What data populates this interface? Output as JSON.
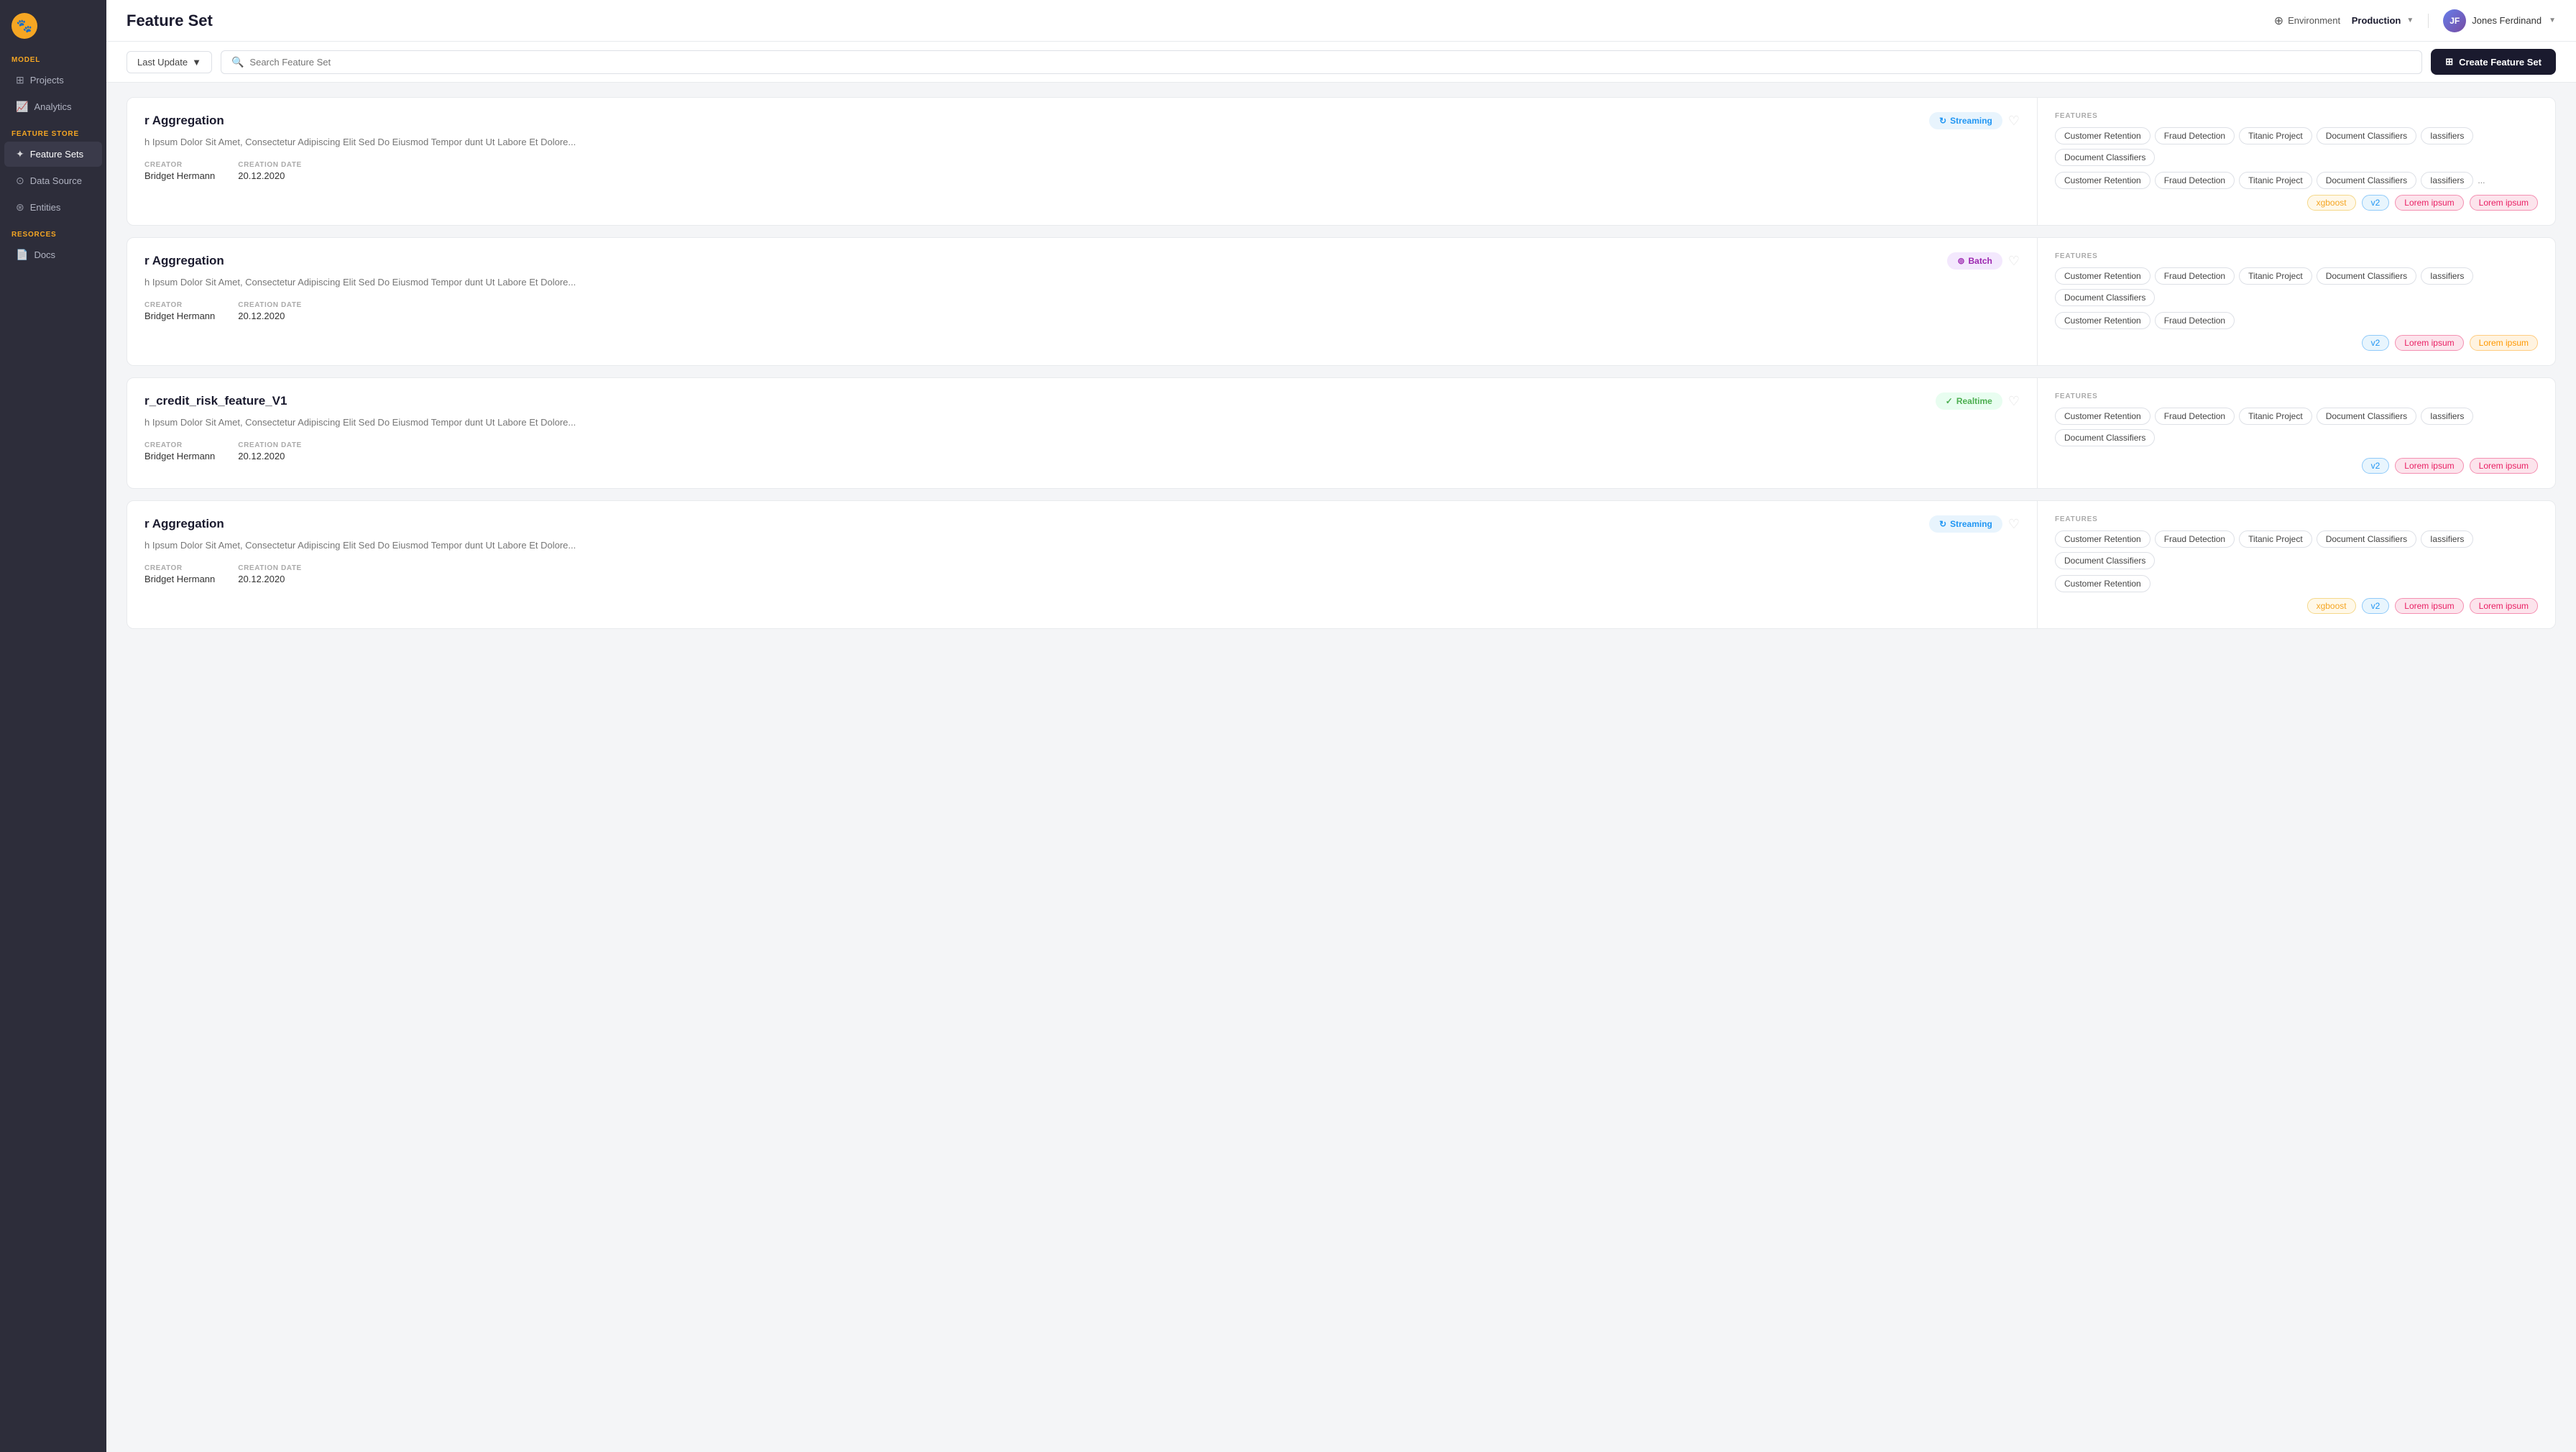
{
  "sidebar": {
    "logo": "🐾",
    "sections": [
      {
        "label": "MODEL",
        "items": [
          {
            "id": "projects",
            "icon": "⊞",
            "label": "Projects",
            "active": false
          },
          {
            "id": "analytics",
            "icon": "📈",
            "label": "Analytics",
            "active": false
          }
        ]
      },
      {
        "label": "FEATURE STORE",
        "items": [
          {
            "id": "feature-sets",
            "icon": "✦",
            "label": "Feature Sets",
            "active": true
          },
          {
            "id": "data-source",
            "icon": "⊙",
            "label": "Data Source",
            "active": false
          },
          {
            "id": "entities",
            "icon": "⊛",
            "label": "Entities",
            "active": false
          }
        ]
      },
      {
        "label": "RESORCES",
        "items": [
          {
            "id": "docs",
            "icon": "📄",
            "label": "Docs",
            "active": false
          }
        ]
      }
    ]
  },
  "header": {
    "title": "Feature Set",
    "environment_label": "Environment",
    "environment_value": "Production",
    "user_name": "Jones Ferdinand",
    "user_initials": "JF"
  },
  "toolbar": {
    "filter_label": "Last Update",
    "search_placeholder": "Search Feature Set",
    "create_label": "Create Feature Set"
  },
  "cards": [
    {
      "id": "card-1",
      "title": "r Aggregation",
      "type": "Streaming",
      "type_variant": "streaming",
      "liked": false,
      "description": "h Ipsum Dolor Sit Amet, Consectetur Adipiscing Elit Sed Do Eiusmod Tempor dunt Ut Labore Et Dolore...",
      "creator": "Bridget Hermann",
      "creation_date": "20.12.2020",
      "creator_label": "CREATOR",
      "date_label": "CREATION DATE",
      "features_label": "FEATURES",
      "features_row1": [
        "Customer Retention",
        "Fraud Detection",
        "Titanic Project",
        "Document Classifiers",
        "Iassifiers",
        "Document Classifiers"
      ],
      "features_row2": [
        "Customer Retention",
        "Fraud Detection",
        "Titanic Project",
        "Document Classifiers",
        "Iassifiers"
      ],
      "features_more": "...",
      "versions": [
        {
          "label": "xgboost",
          "style": "xgboost"
        },
        {
          "label": "v2",
          "style": "v2"
        },
        {
          "label": "Lorem ipsum",
          "style": "pink"
        },
        {
          "label": "Lorem ipsum",
          "style": "pink"
        }
      ]
    },
    {
      "id": "card-2",
      "title": "r Aggregation",
      "type": "Batch",
      "type_variant": "batch",
      "liked": false,
      "description": "h Ipsum Dolor Sit Amet, Consectetur Adipiscing Elit Sed Do Eiusmod Tempor dunt Ut Labore Et Dolore...",
      "creator": "Bridget Hermann",
      "creation_date": "20.12.2020",
      "creator_label": "CREATOR",
      "date_label": "CREATION DATE",
      "features_label": "FEATURES",
      "features_row1": [
        "Customer Retention",
        "Fraud Detection",
        "Titanic Project",
        "Document Classifiers",
        "Iassifiers",
        "Document Classifiers"
      ],
      "features_row2": [
        "Customer Retention",
        "Fraud Detection"
      ],
      "features_more": "",
      "versions": [
        {
          "label": "v2",
          "style": "v2"
        },
        {
          "label": "Lorem ipsum",
          "style": "pink"
        },
        {
          "label": "Lorem ipsum",
          "style": "orange"
        }
      ]
    },
    {
      "id": "card-3",
      "title": "r_credit_risk_feature_V1",
      "type": "Realtime",
      "type_variant": "realtime",
      "liked": false,
      "description": "h Ipsum Dolor Sit Amet, Consectetur Adipiscing Elit Sed Do Eiusmod Tempor dunt Ut Labore Et Dolore...",
      "creator": "Bridget Hermann",
      "creation_date": "20.12.2020",
      "creator_label": "CREATOR",
      "date_label": "CREATION DATE",
      "features_label": "FEATURES",
      "features_row1": [
        "Customer Retention",
        "Fraud Detection",
        "Titanic Project",
        "Document Classifiers",
        "Iassifiers",
        "Document Classifiers"
      ],
      "features_row2": [],
      "features_more": "",
      "versions": [
        {
          "label": "v2",
          "style": "v2"
        },
        {
          "label": "Lorem ipsum",
          "style": "pink"
        },
        {
          "label": "Lorem ipsum",
          "style": "pink"
        }
      ]
    },
    {
      "id": "card-4",
      "title": "r Aggregation",
      "type": "Streaming",
      "type_variant": "streaming",
      "liked": false,
      "description": "h Ipsum Dolor Sit Amet, Consectetur Adipiscing Elit Sed Do Eiusmod Tempor dunt Ut Labore Et Dolore...",
      "creator": "Bridget Hermann",
      "creation_date": "20.12.2020",
      "creator_label": "CREATOR",
      "date_label": "CREATION DATE",
      "features_label": "FEATURES",
      "features_row1": [
        "Customer Retention",
        "Fraud Detection",
        "Titanic Project",
        "Document Classifiers",
        "Iassifiers",
        "Document Classifiers"
      ],
      "features_row2": [
        "Customer Retention"
      ],
      "features_more": "",
      "versions": [
        {
          "label": "xgboost",
          "style": "xgboost"
        },
        {
          "label": "v2",
          "style": "v2"
        },
        {
          "label": "Lorem ipsum",
          "style": "pink"
        },
        {
          "label": "Lorem ipsum",
          "style": "pink"
        }
      ]
    }
  ]
}
